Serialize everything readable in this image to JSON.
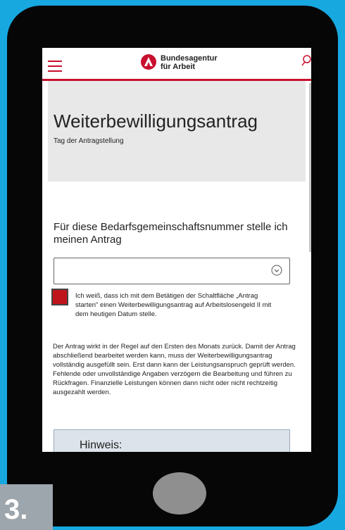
{
  "header": {
    "logo_line1": "Bundesagentur",
    "logo_line2": "für Arbeit",
    "brand_color": "#c8102e",
    "menu_icon": "hamburger-menu-icon",
    "search_icon": "search-icon"
  },
  "hero": {
    "title": "Weiterbewilligungsantrag",
    "subtitle": "Tag der Antragstellung"
  },
  "form": {
    "question": "Für diese Bedarfsgemeinschaftsnummer stelle ich meinen Antrag",
    "select_value": "",
    "checkbox_label": "Ich weiß, dass ich mit dem Betätigen der Schaltfläche „Antrag starten\" einen Weiterbewilligungsantrag auf Arbeitslosengeld II mit dem heutigen Datum stelle.",
    "checkbox_color": "#c0141c"
  },
  "body_text": "Der Antrag wirkt in der Regel auf den Ersten des Monats zurück. Damit der Antrag abschließend bearbeitet werden kann, muss der Weiterbewilligungsantrag vollständig ausgefüllt sein. Erst dann kann der Leistungsanspruch geprüft werden. Fehlende oder unvollständige Angaben verzögern die Bearbeitung und führen zu Rückfragen. Finanzielle Leistungen können dann nicht oder nicht rechtzeitig ausgezahlt werden.",
  "notice": {
    "title": "Hinweis:"
  },
  "step_badge": "3."
}
